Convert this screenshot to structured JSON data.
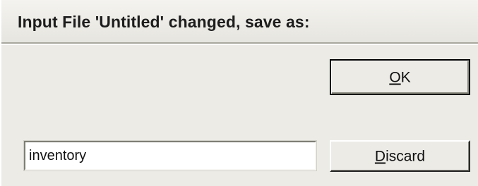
{
  "dialog": {
    "title": "Input File 'Untitled' changed, save as:"
  },
  "buttons": {
    "ok": {
      "mnemonic": "O",
      "rest": "K"
    },
    "discard": {
      "mnemonic": "D",
      "rest": "iscard"
    }
  },
  "filename_input": {
    "value": "inventory"
  }
}
